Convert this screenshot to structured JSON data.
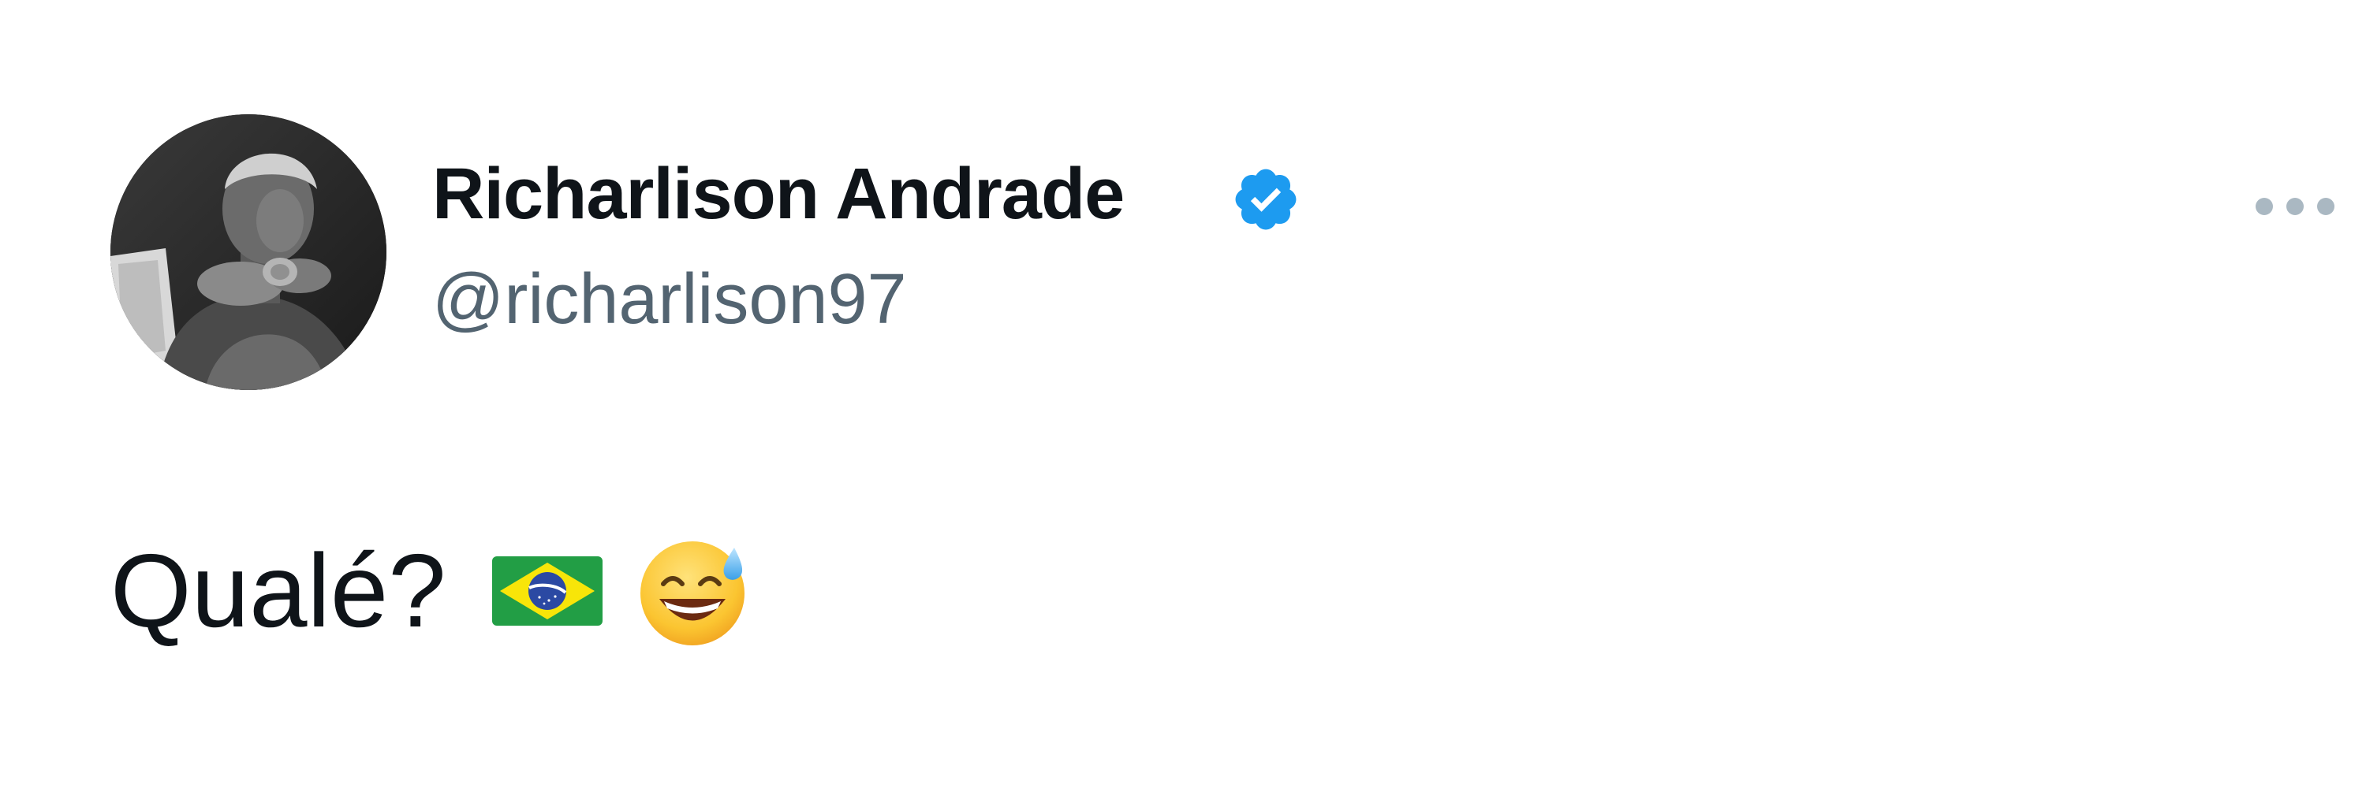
{
  "author": {
    "display_name": "Richarlison Andrade",
    "handle": "@richarlison97",
    "verified": true,
    "avatar_icon": "profile-photo"
  },
  "tweet": {
    "text": "Qualé?",
    "emojis": [
      "brazil-flag-emoji",
      "grinning-face-with-sweat-emoji"
    ]
  },
  "actions": {
    "more_icon": "more-options-icon"
  },
  "colors": {
    "name": "#0f1419",
    "handle": "#536471",
    "verified_badge": "#1d9bf0",
    "more_dots": "#aab8c2"
  }
}
